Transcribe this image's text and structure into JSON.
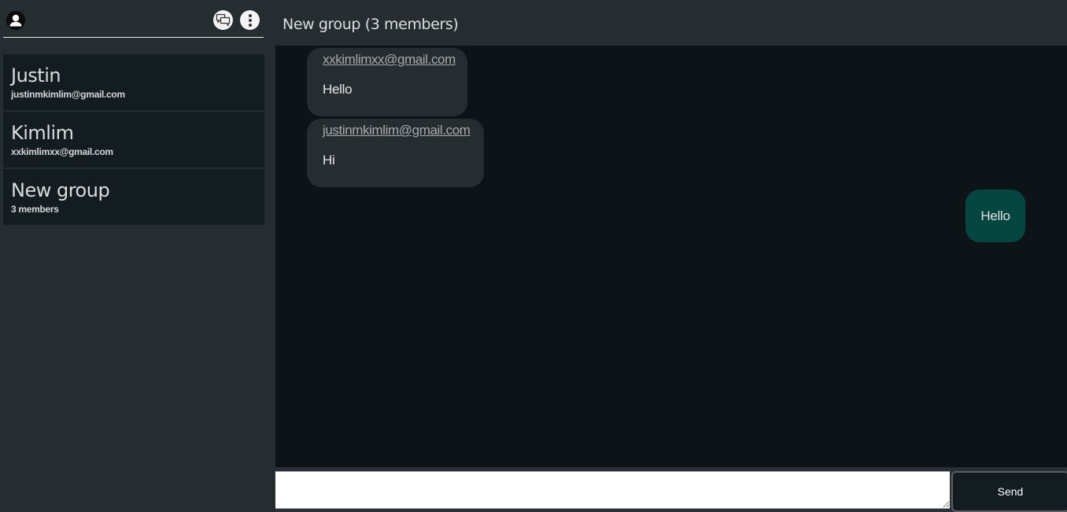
{
  "sidebar": {
    "header": {
      "avatar_icon": "user-avatar-icon",
      "chats_icon": "chat-bubbles-icon",
      "menu_icon": "more-vertical-icon"
    },
    "conversations": [
      {
        "name": "Justin",
        "subtitle": "justinmkimlim@gmail.com"
      },
      {
        "name": "Kimlim",
        "subtitle": "xxkimlimxx@gmail.com"
      },
      {
        "name": "New group",
        "subtitle": "3 members"
      }
    ]
  },
  "chat": {
    "title": "New group (3 members)",
    "messages": [
      {
        "direction": "incoming",
        "sender": "xxkimlimxx@gmail.com",
        "text": "Hello"
      },
      {
        "direction": "incoming",
        "sender": "justinmkimlim@gmail.com",
        "text": "Hi"
      },
      {
        "direction": "outgoing",
        "text": "Hello"
      }
    ],
    "composer": {
      "input_value": "",
      "send_label": "Send"
    }
  },
  "colors": {
    "sidebar_bg": "#262d31",
    "list_item_bg": "#131c21",
    "messages_bg": "#0d1418",
    "incoming_bubble": "#262d31",
    "outgoing_bubble": "#054740"
  }
}
